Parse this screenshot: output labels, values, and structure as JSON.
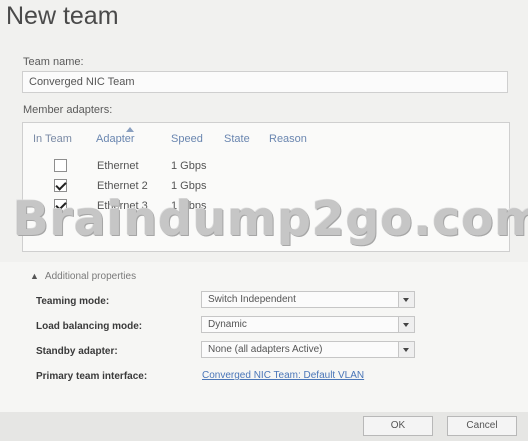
{
  "window": {
    "title": "New team"
  },
  "team_name": {
    "label": "Team name:",
    "value": "Converged NIC Team"
  },
  "member_adapters": {
    "label": "Member adapters:",
    "columns": [
      "In Team",
      "Adapter",
      "Speed",
      "State",
      "Reason"
    ],
    "rows": [
      {
        "in_team": false,
        "adapter": "Ethernet",
        "speed": "1 Gbps"
      },
      {
        "in_team": true,
        "adapter": "Ethernet 2",
        "speed": "1 Gbps"
      },
      {
        "in_team": true,
        "adapter": "Ethernet 3",
        "speed": "1 Gbps"
      }
    ]
  },
  "watermark": "Braindump2go.com",
  "additional": {
    "label": "Additional properties",
    "teaming_mode": {
      "label": "Teaming mode:",
      "value": "Switch Independent"
    },
    "load_balancing": {
      "label": "Load balancing mode:",
      "value": "Dynamic"
    },
    "standby": {
      "label": "Standby adapter:",
      "value": "None (all adapters Active)"
    },
    "primary": {
      "label": "Primary team interface:",
      "link": "Converged NIC Team: Default VLAN"
    }
  },
  "buttons": {
    "ok": "OK",
    "cancel": "Cancel"
  },
  "icons": {
    "expander": "chevron-up-icon",
    "dropdown": "chevron-down-icon",
    "sort": "sort-ascending-icon",
    "check": "checkmark-icon"
  }
}
